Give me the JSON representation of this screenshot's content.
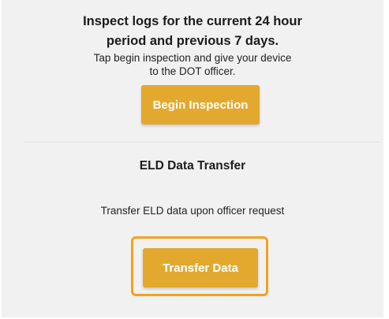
{
  "inspection": {
    "heading_line1": "Inspect logs for the current 24 hour",
    "heading_line2": "period and previous 7 days.",
    "instruction_line1": "Tap begin inspection and give your device",
    "instruction_line2": "to the DOT officer.",
    "begin_button_label": "Begin Inspection"
  },
  "eld_transfer": {
    "title": "ELD Data Transfer",
    "description": "Transfer ELD data upon officer request",
    "transfer_button_label": "Transfer Data"
  },
  "colors": {
    "button_fill": "#e3a92e",
    "highlight_border": "#f4a21c",
    "panel_background": "#f1f1f1"
  }
}
